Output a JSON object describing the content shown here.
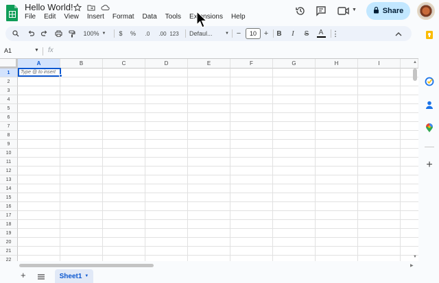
{
  "document": {
    "title": "Hello World!",
    "menu": [
      "File",
      "Edit",
      "View",
      "Insert",
      "Format",
      "Data",
      "Tools",
      "Extensions",
      "Help"
    ],
    "share_label": "Share"
  },
  "toolbar": {
    "zoom": "100%",
    "currency": "$",
    "percent": "%",
    "decrease_decimals": ".0",
    "increase_decimals": ".00",
    "number_format": "123",
    "font_family": "Defaul...",
    "font_size": "10",
    "minus": "−",
    "plus": "+",
    "bold": "B",
    "italic": "I",
    "strike": "S",
    "text_color": "A",
    "more": "⋮",
    "collapse": "⌃"
  },
  "formula_bar": {
    "cell_ref": "A1",
    "fx": "fx",
    "value": ""
  },
  "grid": {
    "columns": [
      "A",
      "B",
      "C",
      "D",
      "E",
      "F",
      "G",
      "H",
      "I"
    ],
    "rows": [
      "1",
      "2",
      "3",
      "4",
      "5",
      "6",
      "7",
      "8",
      "9",
      "10",
      "11",
      "12",
      "13",
      "14",
      "15",
      "16",
      "17",
      "18",
      "19",
      "20",
      "21",
      "22"
    ],
    "selected_cell": "A1",
    "active_cell_placeholder": "Type @ to insert"
  },
  "sheets": {
    "add": "+",
    "tabs": [
      {
        "label": "Sheet1",
        "active": true
      }
    ]
  },
  "colors": {
    "accent": "#0b57d0",
    "share_bg": "#c2e7ff",
    "toolbar_bg": "#edf2fa",
    "sheets_green": "#0f9d58"
  },
  "icons": {
    "title": [
      "star-icon",
      "folder-move-icon",
      "cloud-saved-icon"
    ],
    "header_right": [
      "version-history-icon",
      "comments-icon",
      "meet-icon",
      "lock-icon"
    ],
    "side_panel": [
      "keep-icon",
      "tasks-icon",
      "contacts-icon",
      "maps-icon",
      "add-icon"
    ]
  }
}
